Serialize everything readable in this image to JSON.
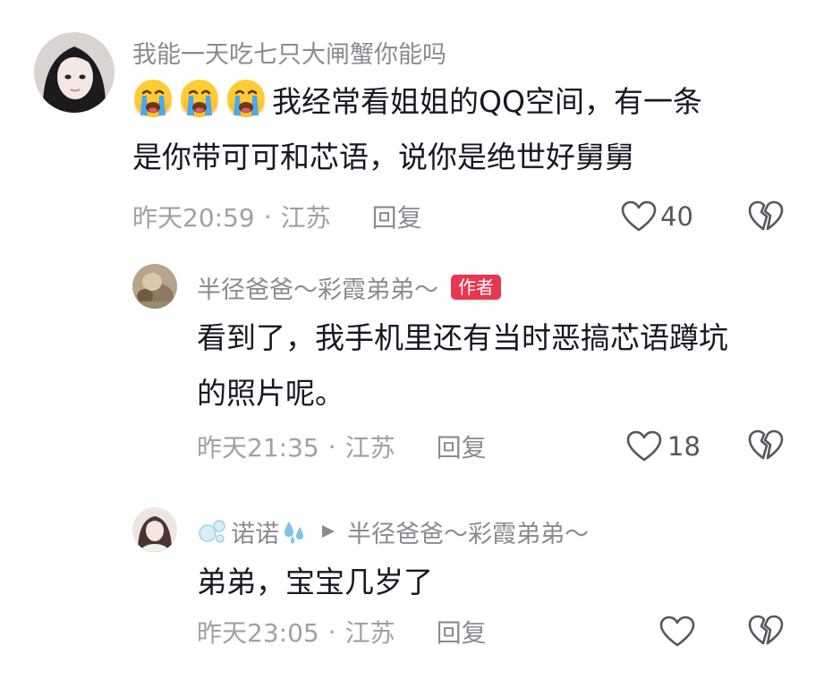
{
  "comments": [
    {
      "username": "我能一天吃七只大闸蟹你能吗",
      "content_lines": [
        "我经常看姐姐的QQ空间，有一条",
        "是你带可可和芯语，说你是绝世好舅舅"
      ],
      "time": "昨天20:59",
      "location": "江苏",
      "reply_label": "回复",
      "likes": "40",
      "emoji_count": 3
    },
    {
      "username": "半径爸爸～彩霞弟弟～",
      "badge": "作者",
      "content_lines": [
        "看到了，我手机里还有当时恶搞芯语蹲坑",
        "的照片呢。"
      ],
      "time": "昨天21:35",
      "location": "江苏",
      "reply_label": "回复",
      "likes": "18"
    },
    {
      "username": "诺诺",
      "reply_to": "半径爸爸～彩霞弟弟～",
      "content_lines": [
        "弟弟，宝宝几岁了"
      ],
      "time": "昨天23:05",
      "location": "江苏",
      "reply_label": "回复",
      "likes": ""
    }
  ],
  "separator_dot": "·",
  "colors": {
    "text_primary": "#161823",
    "text_secondary": "#8a8b91",
    "author_badge": "#e8384f"
  },
  "icons": [
    "crying-face-icon",
    "heart-outline-icon",
    "broken-heart-icon",
    "bubbles-icon",
    "sweat-droplets-icon",
    "play-triangle-icon"
  ]
}
